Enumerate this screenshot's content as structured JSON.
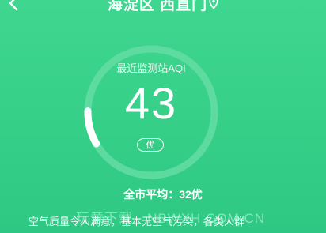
{
  "header": {
    "location": "海淀区 西直门",
    "icons": [
      "back-chevron-icon",
      "location-pin-icon"
    ]
  },
  "gauge": {
    "label": "最近监测站AQI",
    "value": "43",
    "level": "优",
    "fill_fraction": 0.086
  },
  "city_average": "全市平均：32优",
  "advice": "空气质量令人满意，基本无空气污染，各类人群",
  "watermark": "玩意下载 · NBWXH.COM.CN",
  "colors": {
    "background": "#36cf88",
    "ring_track": "#62dca3",
    "ring_fill": "#ffffff"
  }
}
